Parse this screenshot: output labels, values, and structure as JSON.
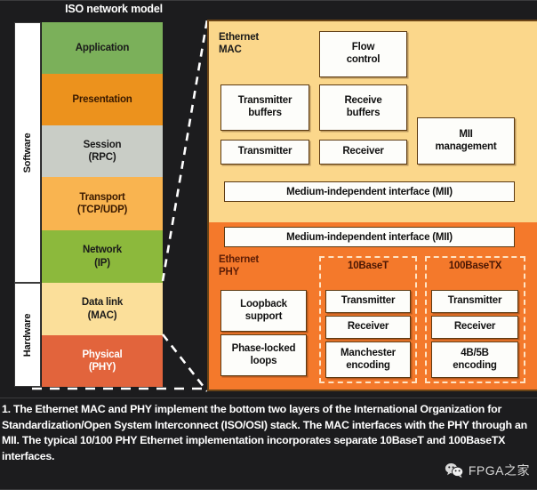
{
  "figure": {
    "title": "ISO network model",
    "caption": "1. The Ethernet MAC and PHY implement the bottom two layers of the International Organization for Standardization/Open System Interconnect (ISO/OSI) stack. The MAC interfaces with the PHY through an MII. The typical 10/100 PHY Ethernet implementation incorporates separate 10BaseT and 100BaseTX interfaces.",
    "background": "#1c1c1e"
  },
  "iso_stack": {
    "domains": [
      {
        "label": "Software",
        "span_layers": 5
      },
      {
        "label": "Hardware",
        "span_layers": 2
      }
    ],
    "layers": [
      {
        "name": "Application",
        "text": "Application",
        "color": "#7bb05a",
        "text_color": "#1a1a1a"
      },
      {
        "name": "Presentation",
        "text": "Presentation",
        "color": "#ec921d",
        "text_color": "#3a1a00"
      },
      {
        "name": "Session",
        "text": "Session\n(RPC)",
        "color": "#c9cdc6",
        "text_color": "#1a1a1a"
      },
      {
        "name": "Transport",
        "text": "Transport\n(TCP/UDP)",
        "color": "#f9b450",
        "text_color": "#3a1a00"
      },
      {
        "name": "Network",
        "text": "Network\n(IP)",
        "color": "#8cb93c",
        "text_color": "#1a1a1a"
      },
      {
        "name": "Data link",
        "text": "Data link\n(MAC)",
        "color": "#fbdf9a",
        "text_color": "#1a1a1a"
      },
      {
        "name": "Physical",
        "text": "Physical\n(PHY)",
        "color": "#e2643c",
        "text_color": "#ffffff"
      }
    ]
  },
  "panel": {
    "mac": {
      "region_label": "Ethernet\nMAC",
      "color": "#fbd78b",
      "blocks": [
        {
          "id": "flow-control",
          "label": "Flow\ncontrol"
        },
        {
          "id": "transmitter-buffers",
          "label": "Transmitter\nbuffers"
        },
        {
          "id": "receive-buffers",
          "label": "Receive\nbuffers"
        },
        {
          "id": "mii-management",
          "label": "MII\nmanagement"
        },
        {
          "id": "transmitter",
          "label": "Transmitter"
        },
        {
          "id": "receiver",
          "label": "Receiver"
        }
      ],
      "mii_bar_top": "Medium-independent interface (MII)"
    },
    "phy": {
      "region_label": "Ethernet\nPHY",
      "color": "#f4792b",
      "mii_bar_bottom": "Medium-independent interface (MII)",
      "common_blocks": [
        {
          "id": "loopback-support",
          "label": "Loopback\nsupport"
        },
        {
          "id": "phase-locked-loops",
          "label": "Phase-locked\nloops"
        }
      ],
      "groups": [
        {
          "id": "10baset",
          "title": "10BaseT",
          "blocks": [
            {
              "id": "transmitter",
              "label": "Transmitter"
            },
            {
              "id": "receiver",
              "label": "Receiver"
            },
            {
              "id": "manchester-encoding",
              "label": "Manchester\nencoding"
            }
          ]
        },
        {
          "id": "100basetx",
          "title": "100BaseTX",
          "blocks": [
            {
              "id": "transmitter",
              "label": "Transmitter"
            },
            {
              "id": "receiver",
              "label": "Receiver"
            },
            {
              "id": "4b5b-encoding",
              "label": "4B/5B\nencoding"
            }
          ]
        }
      ]
    }
  },
  "watermark": {
    "text": "FPGA之家",
    "icon": "wechat-icon"
  }
}
